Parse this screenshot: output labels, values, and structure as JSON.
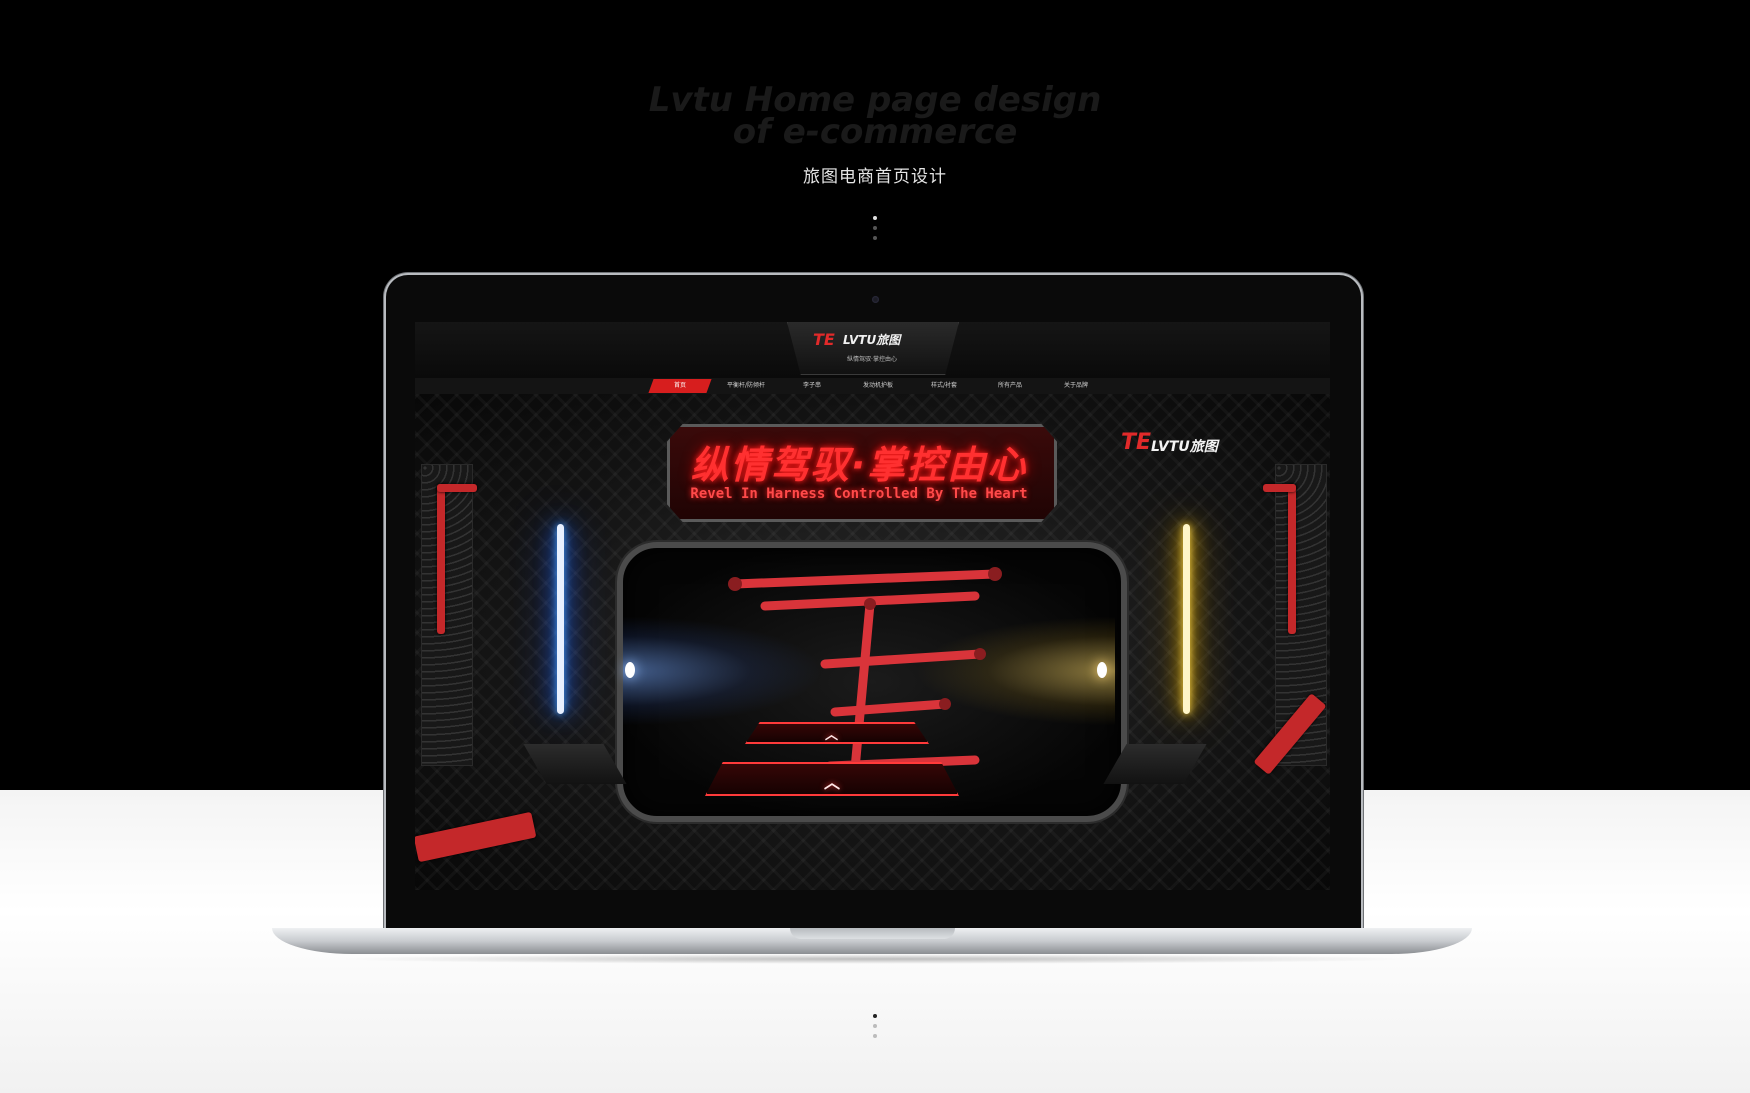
{
  "hero": {
    "title_line1": "Lvtu Home page design",
    "title_line2": "of e-commerce",
    "subtitle": "旅图电商首页设计"
  },
  "site": {
    "logo_text": "LVTU旅图",
    "slogan": "纵情驾驭·掌控由心",
    "nav": [
      {
        "label": "首页",
        "active": true
      },
      {
        "label": "平衡杆/防倾杆",
        "active": false
      },
      {
        "label": "李子串",
        "active": false
      },
      {
        "label": "发动机护板",
        "active": false
      },
      {
        "label": "样式/衬套",
        "active": false
      },
      {
        "label": "所有产品",
        "active": false
      },
      {
        "label": "关于品牌",
        "active": false
      }
    ]
  },
  "banner": {
    "headline_cn": "纵情驾驭·掌控由心",
    "headline_en": "Revel In Harness Controlled By The Heart",
    "brand_logo_text": "LVTU旅图",
    "neon_colors": {
      "left": "#1e6bff",
      "right": "#ffc400",
      "accent": "#ff2020"
    }
  },
  "icons": {
    "chevron": "chevron-up-icon",
    "logo_mark": "te-logo-icon"
  }
}
